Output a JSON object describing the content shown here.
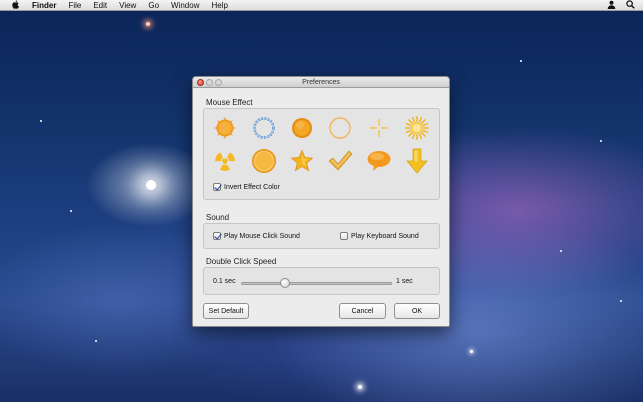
{
  "menubar": {
    "apple_icon": "apple-icon",
    "app_name": "Finder",
    "items": [
      "File",
      "Edit",
      "View",
      "Go",
      "Window",
      "Help"
    ],
    "right_icons": [
      "user-icon",
      "spotlight-icon"
    ]
  },
  "window": {
    "title": "Preferences",
    "mouse_effect": {
      "title": "Mouse Effect",
      "effects": [
        {
          "icon": "orange-starburst-icon",
          "color": "#f39a1e"
        },
        {
          "icon": "blue-ring-icon",
          "color": "#6fa0d8"
        },
        {
          "icon": "orange-circle-icon",
          "color": "#f0a21a"
        },
        {
          "icon": "orange-outline-circle-icon",
          "color": "#f3b35a"
        },
        {
          "icon": "crosshair-icon",
          "color": "#f5c04a"
        },
        {
          "icon": "sunburst-icon",
          "color": "#f2b830"
        },
        {
          "icon": "radiation-icon",
          "color": "#f5b820"
        },
        {
          "icon": "orange-disc-icon",
          "color": "#f0a820"
        },
        {
          "icon": "star-icon",
          "color": "#f5b31a"
        },
        {
          "icon": "checkmark-icon",
          "color": "#e9ad3a"
        },
        {
          "icon": "speech-bubble-icon",
          "color": "#f39a1e"
        },
        {
          "icon": "down-arrow-icon",
          "color": "#f2c020"
        }
      ],
      "invert_label": "Invert Effect Color",
      "invert_checked": true
    },
    "sound": {
      "title": "Sound",
      "mouse_click_label": "Play Mouse Click Sound",
      "mouse_click_checked": true,
      "keyboard_label": "Play Keyboard Sound",
      "keyboard_checked": false
    },
    "double_click": {
      "title": "Double Click Speed",
      "min_label": "0.1 sec",
      "max_label": "1 sec",
      "slider_fraction": 0.29
    },
    "buttons": {
      "set_default": "Set Default",
      "cancel": "Cancel",
      "ok": "OK"
    }
  }
}
